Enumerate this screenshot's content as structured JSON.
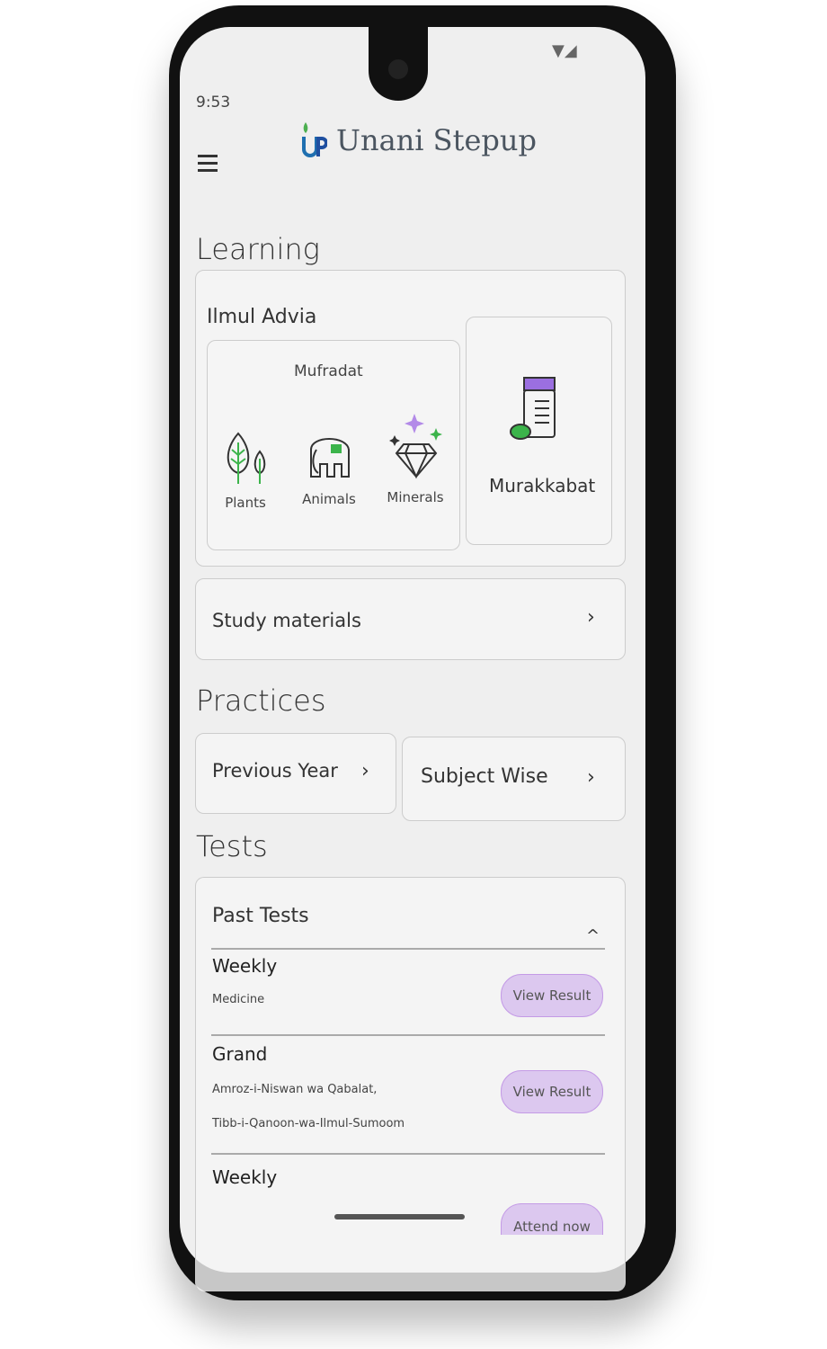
{
  "status_bar": {
    "time": "9:53",
    "icons": [
      "wifi-icon",
      "cellular-signal-icon"
    ]
  },
  "header": {
    "app_title": "Unani Stepup",
    "menu_icon": "hamburger-menu-icon",
    "brand_colors": {
      "leaf": "#4caf50",
      "letter": "#1f4fa0"
    }
  },
  "learning": {
    "title": "Learning",
    "ilmul_advia": {
      "title": "Ilmul Advia",
      "mufradat": {
        "title": "Mufradat",
        "items": [
          {
            "label": "Plants",
            "icon": "leaf-icon"
          },
          {
            "label": "Animals",
            "icon": "elephant-icon"
          },
          {
            "label": "Minerals",
            "icon": "diamond-icon"
          }
        ]
      },
      "murakkabat": {
        "label": "Murakkabat",
        "icon": "medicine-jar-icon"
      }
    },
    "study_materials": "Study materials"
  },
  "practices": {
    "title": "Practices",
    "previous_year": "Previous Year",
    "subject_wise": "Subject Wise"
  },
  "tests": {
    "title": "Tests",
    "past_tests": {
      "title": "Past Tests",
      "items": [
        {
          "type": "Weekly",
          "subjects": [
            "Medicine"
          ],
          "action": "View Result"
        },
        {
          "type": "Grand",
          "subjects": [
            "Amroz-i-Niswan wa Qabalat,",
            "Tibb-i-Qanoon-wa-Ilmul-Sumoom"
          ],
          "action": "View Result"
        },
        {
          "type": "Weekly",
          "subjects": [],
          "action": "Attend now"
        }
      ]
    }
  },
  "accent_color": "#dcc8ef"
}
